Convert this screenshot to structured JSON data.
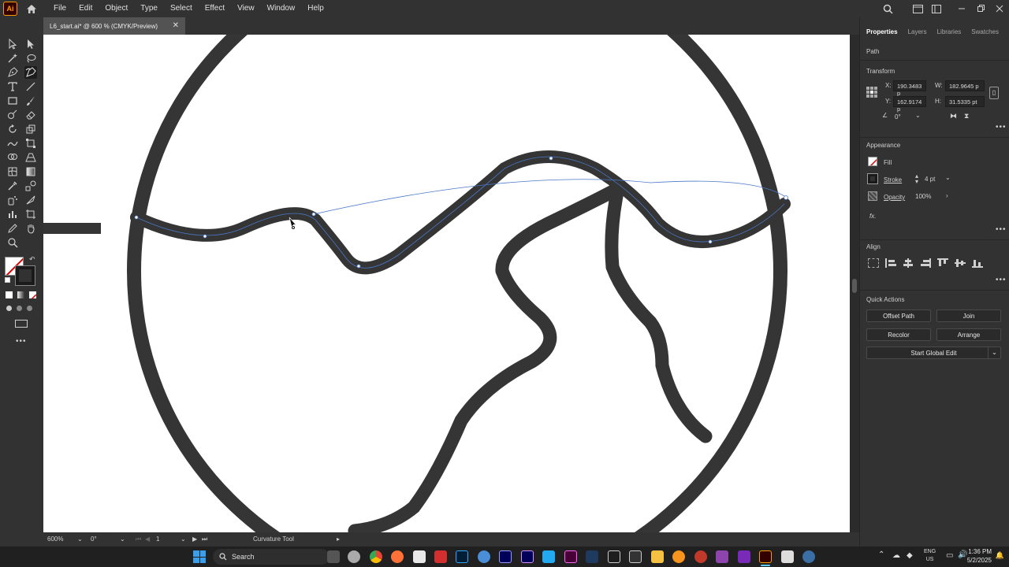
{
  "app": {
    "logo_text": "Ai"
  },
  "menu": [
    "File",
    "Edit",
    "Object",
    "Type",
    "Select",
    "Effect",
    "View",
    "Window",
    "Help"
  ],
  "document": {
    "tab_title": "L6_start.ai* @ 600 % (CMYK/Preview)"
  },
  "status": {
    "zoom": "600%",
    "rotation": "0°",
    "artboard": "1",
    "tool_name": "Curvature Tool"
  },
  "panel": {
    "tabs": [
      "Properties",
      "Layers",
      "Libraries",
      "Swatches"
    ],
    "selection_type": "Path",
    "transform": {
      "section": "Transform",
      "x_label": "X:",
      "x": "190.3483 p",
      "y_label": "Y:",
      "y": "162.9174 p",
      "w_label": "W:",
      "w": "182.9645 p",
      "h_label": "H:",
      "h": "31.5335 pt",
      "angle": "0°"
    },
    "appearance": {
      "section": "Appearance",
      "fill_label": "Fill",
      "stroke_label": "Stroke",
      "stroke_value": "4 pt",
      "opacity_label": "Opacity",
      "opacity_value": "100%",
      "fx_label": "fx."
    },
    "align": {
      "section": "Align"
    },
    "quick_actions": {
      "section": "Quick Actions",
      "offset_path": "Offset Path",
      "join": "Join",
      "recolor": "Recolor",
      "arrange": "Arrange",
      "start_global_edit": "Start Global Edit"
    }
  },
  "taskbar": {
    "search_placeholder": "Search",
    "lang_top": "ENG",
    "lang_bottom": "US",
    "time": "1:36 PM",
    "date": "5/2/2025"
  },
  "colors": {
    "accent_selection": "#4a78c8",
    "stroke_dark": "#353535",
    "illustrator_orange": "#ff9a00"
  }
}
